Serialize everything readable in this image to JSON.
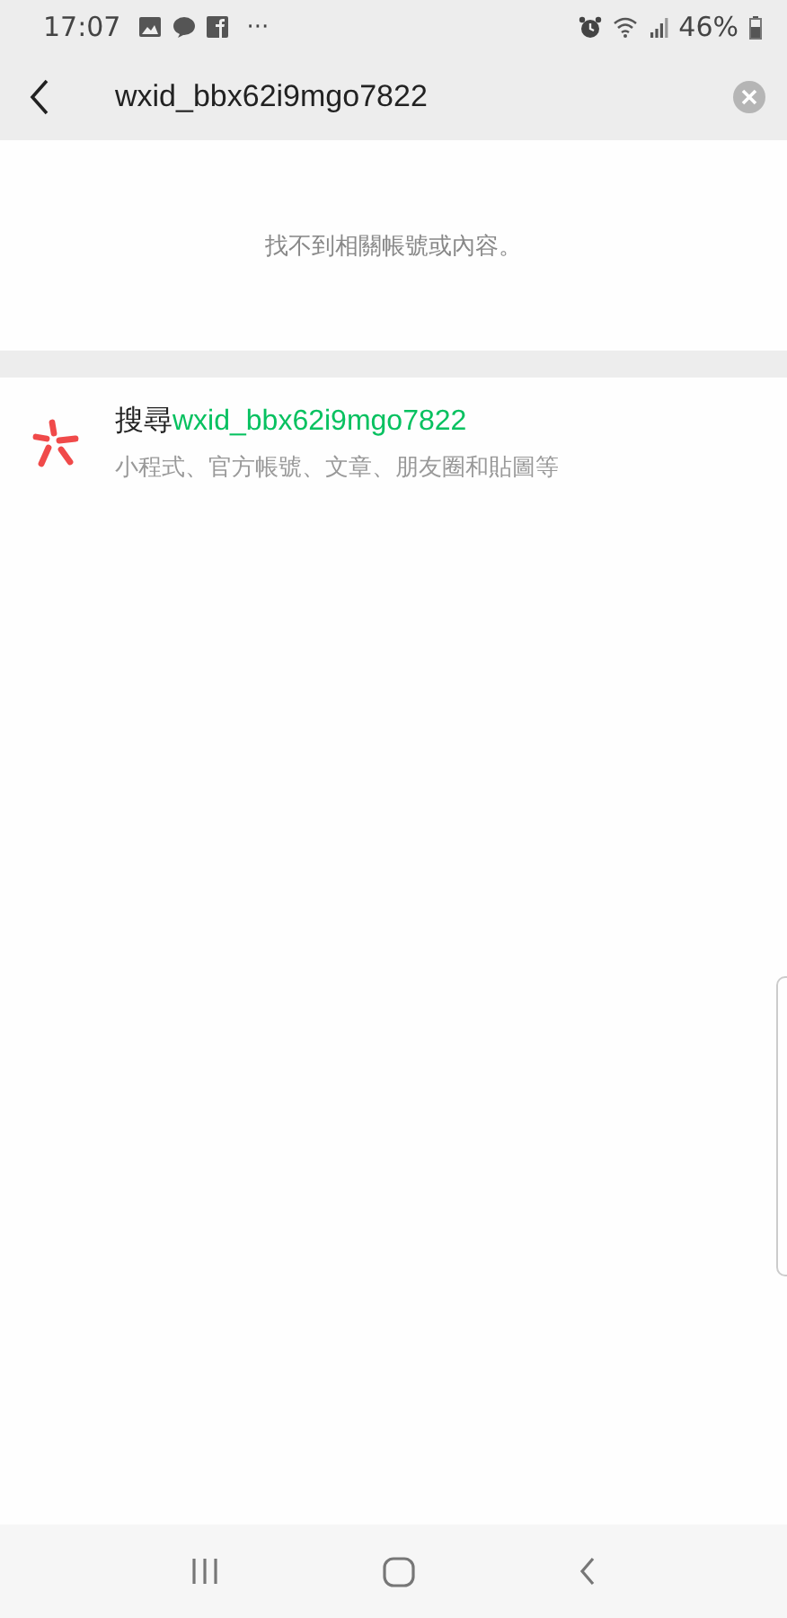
{
  "status_bar": {
    "time": "17:07",
    "more": "···",
    "battery": "46%"
  },
  "search": {
    "value": "wxid_bbx62i9mgo7822"
  },
  "empty_message": "找不到相關帳號或內容。",
  "search_suggestion": {
    "prefix": "搜尋",
    "query": "wxid_bbx62i9mgo7822",
    "subtitle": "小程式、官方帳號、文章、朋友圈和貼圖等"
  }
}
